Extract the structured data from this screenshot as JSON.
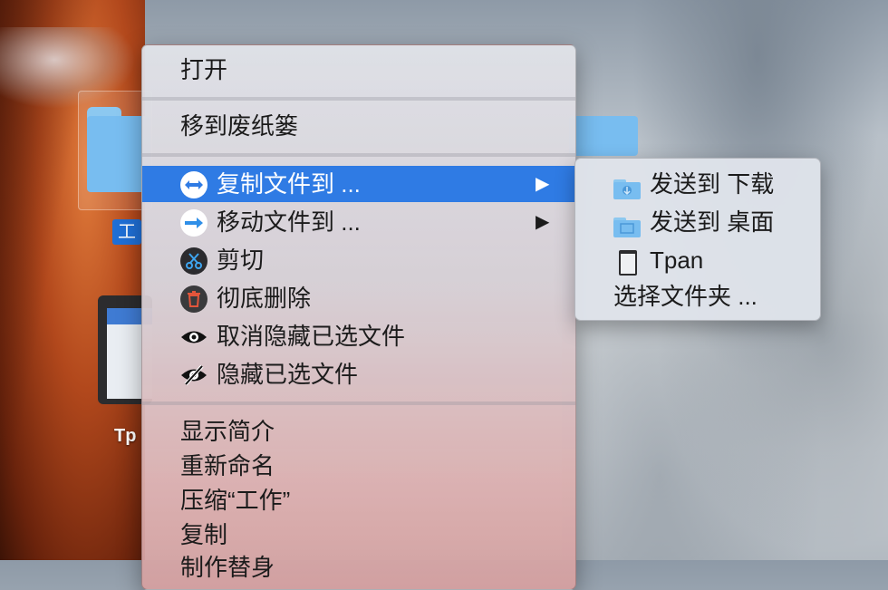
{
  "desktop": {
    "selected_icon_label": "工",
    "tpan_icon_label": "Tp"
  },
  "menu": {
    "open": "打开",
    "move_to_trash": "移到废纸篓",
    "copy_to": "复制文件到 ...",
    "move_to": "移动文件到 ...",
    "cut": "剪切",
    "delete": "彻底删除",
    "unhide": "取消隐藏已选文件",
    "hide": "隐藏已选文件",
    "get_info": "显示简介",
    "rename": "重新命名",
    "compress": "压缩“工作”",
    "duplicate": "复制",
    "make_alias": "制作替身",
    "submenu_arrow": "▶"
  },
  "submenu": {
    "downloads": "发送到 下载",
    "desktop": "发送到 桌面",
    "tpan": "Tpan",
    "choose_folder": "选择文件夹 ..."
  },
  "icons": {
    "copy": "copy-arrow-icon",
    "move": "move-arrow-icon",
    "cut": "scissors-icon",
    "delete": "trash-icon",
    "unhide": "eye-icon",
    "hide": "eye-slash-icon"
  },
  "colors": {
    "selection": "#2f7be4",
    "menu_text": "#1b1b1b",
    "folder": "#78bdf0"
  }
}
